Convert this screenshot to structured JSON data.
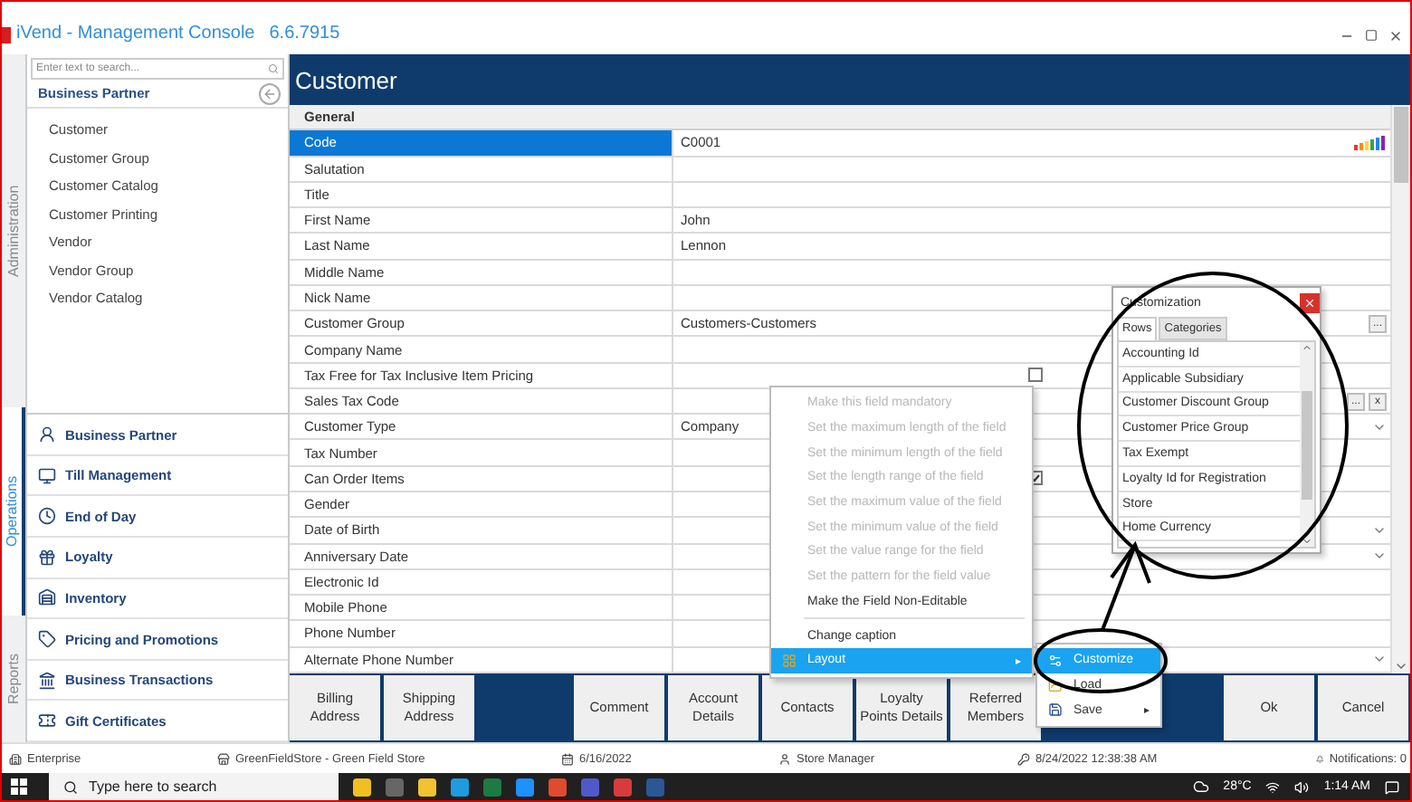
{
  "window": {
    "title": "iVend - Management Console",
    "version": "6.6.7915"
  },
  "sidebar_tabs": [
    {
      "label": "Administration",
      "selected": false
    },
    {
      "label": "Operations",
      "selected": true
    },
    {
      "label": "Reports",
      "selected": false
    }
  ],
  "sidebar": {
    "search_placeholder": "Enter text to search...",
    "section_title": "Business Partner",
    "items": [
      "Customer",
      "Customer Group",
      "Customer Catalog",
      "Customer Printing",
      "Vendor",
      "Vendor Group",
      "Vendor Catalog"
    ],
    "modules": [
      "Business Partner",
      "Till Management",
      "End of Day",
      "Loyalty",
      "Inventory",
      "Pricing and Promotions",
      "Business Transactions",
      "Gift Certificates"
    ]
  },
  "page_title": "Customer",
  "grid": {
    "category": "General",
    "rows": [
      {
        "label": "Code",
        "value": "C0001",
        "selected": true,
        "picker": true
      },
      {
        "label": "Salutation",
        "selected": false
      },
      {
        "label": "Title",
        "selected": false
      },
      {
        "label": "First Name",
        "value": "John",
        "selected": false
      },
      {
        "label": "Last Name",
        "value": "Lennon",
        "selected": false
      },
      {
        "label": "Middle Name",
        "selected": false
      },
      {
        "label": "Nick Name",
        "selected": false
      },
      {
        "label": "Customer Group",
        "value": "Customers-Customers",
        "selected": false,
        "buttons": [
          "..."
        ]
      },
      {
        "label": "Company Name",
        "selected": false
      },
      {
        "label": "Tax Free for Tax Inclusive Item Pricing",
        "selected": false,
        "checked": false
      },
      {
        "label": "Sales Tax Code",
        "selected": false,
        "buttons": [
          "...",
          "x"
        ]
      },
      {
        "label": "Customer Type",
        "value": "Company",
        "selected": false,
        "dropdown": true
      },
      {
        "label": "Tax Number",
        "selected": false
      },
      {
        "label": "Can Order Items",
        "selected": false,
        "checked": true
      },
      {
        "label": "Gender",
        "selected": false
      },
      {
        "label": "Date of Birth",
        "selected": false,
        "dropdown": true
      },
      {
        "label": "Anniversary Date",
        "selected": false,
        "dropdown": true
      },
      {
        "label": "Electronic Id",
        "selected": false
      },
      {
        "label": "Mobile Phone",
        "selected": false
      },
      {
        "label": "Phone Number",
        "selected": false
      },
      {
        "label": "Alternate Phone Number",
        "selected": false,
        "dropdown": true
      }
    ]
  },
  "actions": [
    "Billing Address",
    "Shipping Address",
    "Comment",
    "Account Details",
    "Contacts",
    "Loyalty Points Details",
    "Referred Members"
  ],
  "dialog_buttons": [
    "Ok",
    "Cancel"
  ],
  "context_menu": [
    {
      "label": "Make this field mandatory",
      "disabled": true,
      "selected": false
    },
    {
      "label": "Set the maximum length of the field",
      "disabled": true,
      "selected": false
    },
    {
      "label": "Set the minimum length of the field",
      "disabled": true,
      "selected": false
    },
    {
      "label": "Set the length range of the field",
      "disabled": true,
      "selected": false
    },
    {
      "label": "Set the maximum value of the field",
      "disabled": true,
      "selected": false
    },
    {
      "label": "Set the minimum value of the field",
      "disabled": true,
      "selected": false
    },
    {
      "label": "Set the value range for the field",
      "disabled": true,
      "selected": false
    },
    {
      "label": "Set the pattern for the field value",
      "disabled": true,
      "selected": false
    },
    {
      "label": "Make the Field Non-Editable",
      "disabled": false,
      "selected": false
    },
    {
      "label": "Change caption",
      "disabled": false,
      "selected": false,
      "separator_before": true
    },
    {
      "label": "Layout",
      "disabled": false,
      "selected": true,
      "arrow": "▸"
    }
  ],
  "submenu": [
    {
      "label": "Customize",
      "selected": true
    },
    {
      "label": "Load",
      "selected": false
    },
    {
      "label": "Save",
      "selected": false,
      "arrow": "▸"
    }
  ],
  "customization": {
    "title": "Customization",
    "tabs": [
      {
        "label": "Rows",
        "selected": true
      },
      {
        "label": "Categories",
        "selected": false
      }
    ],
    "items": [
      "Accounting Id",
      "Applicable Subsidiary",
      "Customer Discount Group",
      "Customer Price Group",
      "Tax Exempt",
      "Loyalty Id for Registration",
      "Store",
      "Home Currency"
    ]
  },
  "status_bar": {
    "edition": "Enterprise",
    "store": "GreenFieldStore - Green Field Store",
    "date": "6/16/2022",
    "user": "Store Manager",
    "login_time": "8/24/2022 12:38:38 AM",
    "notifications": "Notifications: 0"
  },
  "taskbar": {
    "search_placeholder": "Type here to search",
    "temperature": "28°C",
    "time": "1:14 AM"
  }
}
